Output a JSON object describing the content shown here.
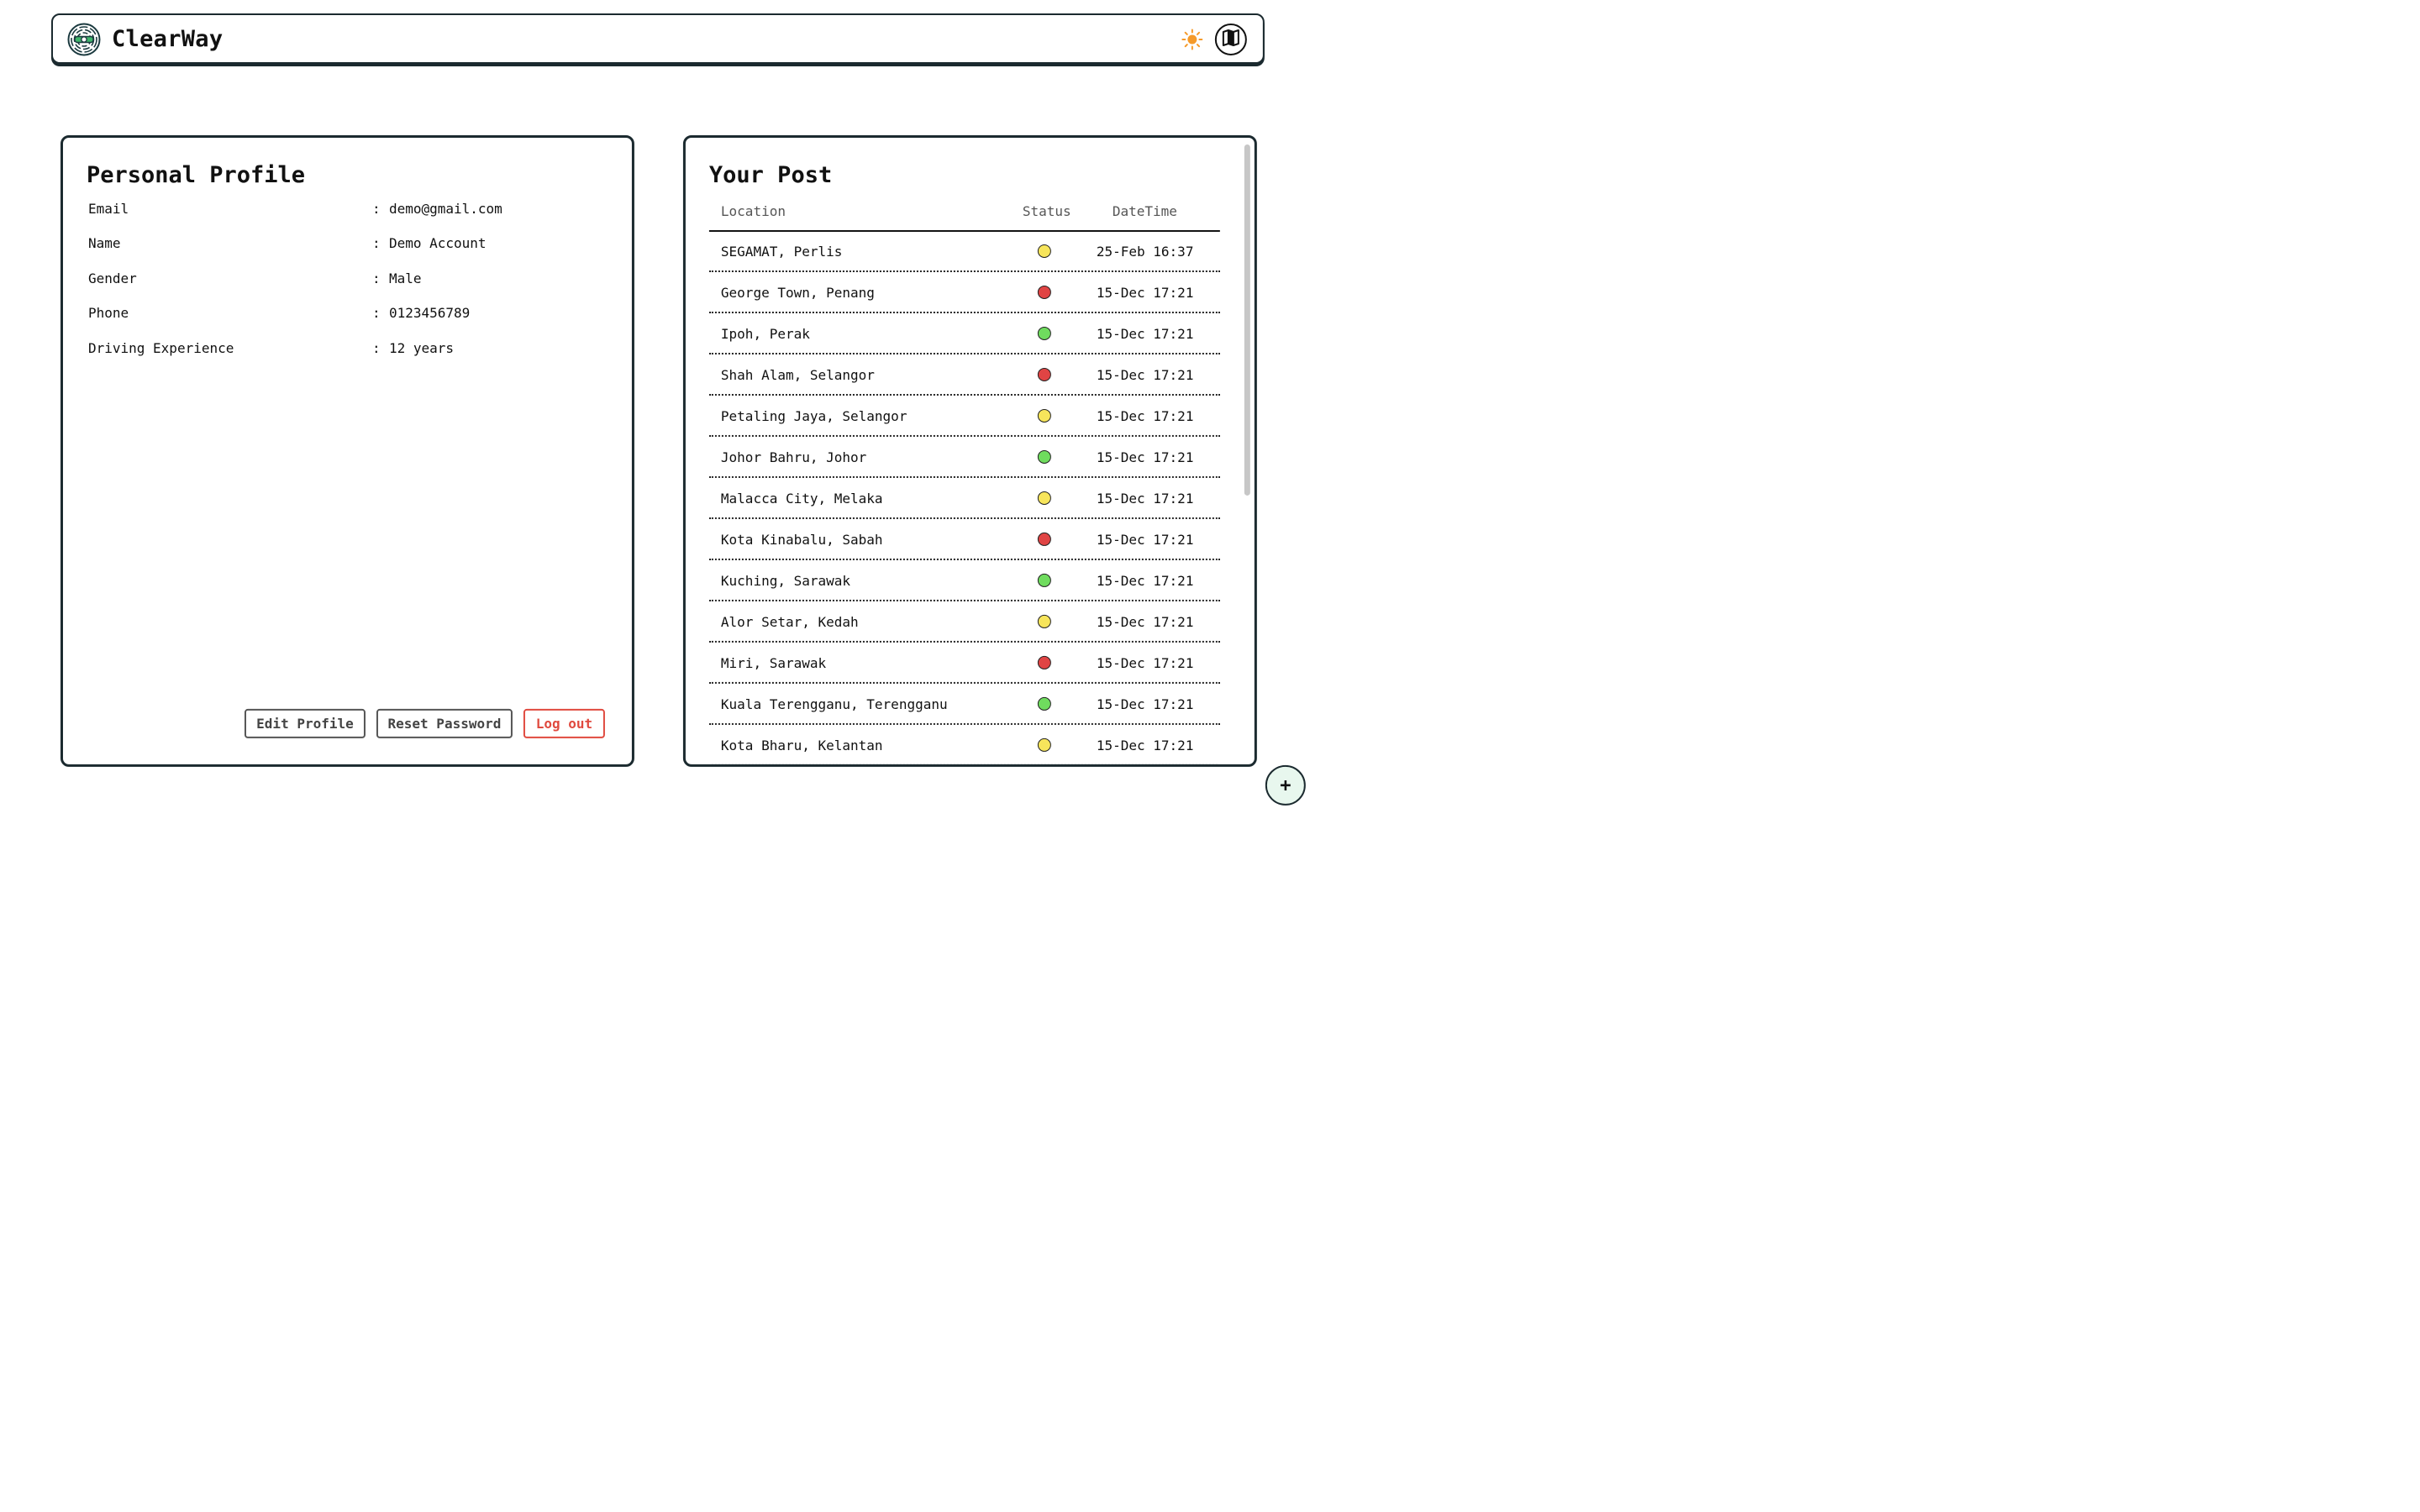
{
  "header": {
    "brand": "ClearWay",
    "logo_icon": "steering-wheel-maze-logo",
    "theme_icon": "sun-icon",
    "map_icon": "map-icon"
  },
  "profile": {
    "title": "Personal Profile",
    "fields": [
      {
        "label": "Email",
        "sep": ":",
        "value": "demo@gmail.com"
      },
      {
        "label": "Name",
        "sep": ":",
        "value": "Demo Account"
      },
      {
        "label": "Gender",
        "sep": ":",
        "value": "Male"
      },
      {
        "label": "Phone",
        "sep": ":",
        "value": "0123456789"
      },
      {
        "label": "Driving Experience",
        "sep": ":",
        "value": "12 years"
      }
    ],
    "buttons": {
      "edit": "Edit Profile",
      "reset": "Reset Password",
      "logout": "Log out"
    }
  },
  "posts": {
    "title": "Your Post",
    "columns": {
      "location": "Location",
      "status": "Status",
      "datetime": "DateTime"
    },
    "rows": [
      {
        "location": "SEGAMAT, Perlis",
        "status": "yellow",
        "datetime": "25-Feb 16:37"
      },
      {
        "location": "George Town, Penang",
        "status": "red",
        "datetime": "15-Dec 17:21"
      },
      {
        "location": "Ipoh, Perak",
        "status": "green",
        "datetime": "15-Dec 17:21"
      },
      {
        "location": "Shah Alam, Selangor",
        "status": "red",
        "datetime": "15-Dec 17:21"
      },
      {
        "location": "Petaling Jaya, Selangor",
        "status": "yellow",
        "datetime": "15-Dec 17:21"
      },
      {
        "location": "Johor Bahru, Johor",
        "status": "green",
        "datetime": "15-Dec 17:21"
      },
      {
        "location": "Malacca City, Melaka",
        "status": "yellow",
        "datetime": "15-Dec 17:21"
      },
      {
        "location": "Kota Kinabalu, Sabah",
        "status": "red",
        "datetime": "15-Dec 17:21"
      },
      {
        "location": "Kuching, Sarawak",
        "status": "green",
        "datetime": "15-Dec 17:21"
      },
      {
        "location": "Alor Setar, Kedah",
        "status": "yellow",
        "datetime": "15-Dec 17:21"
      },
      {
        "location": "Miri, Sarawak",
        "status": "red",
        "datetime": "15-Dec 17:21"
      },
      {
        "location": "Kuala Terengganu, Terengganu",
        "status": "green",
        "datetime": "15-Dec 17:21"
      },
      {
        "location": "Kota Bharu, Kelantan",
        "status": "yellow",
        "datetime": "15-Dec 17:21"
      }
    ]
  },
  "status_colors": {
    "yellow": "#f7e55b",
    "red": "#e04444",
    "green": "#6fdc5e"
  },
  "fab": {
    "label": "+",
    "icon": "plus-icon"
  }
}
